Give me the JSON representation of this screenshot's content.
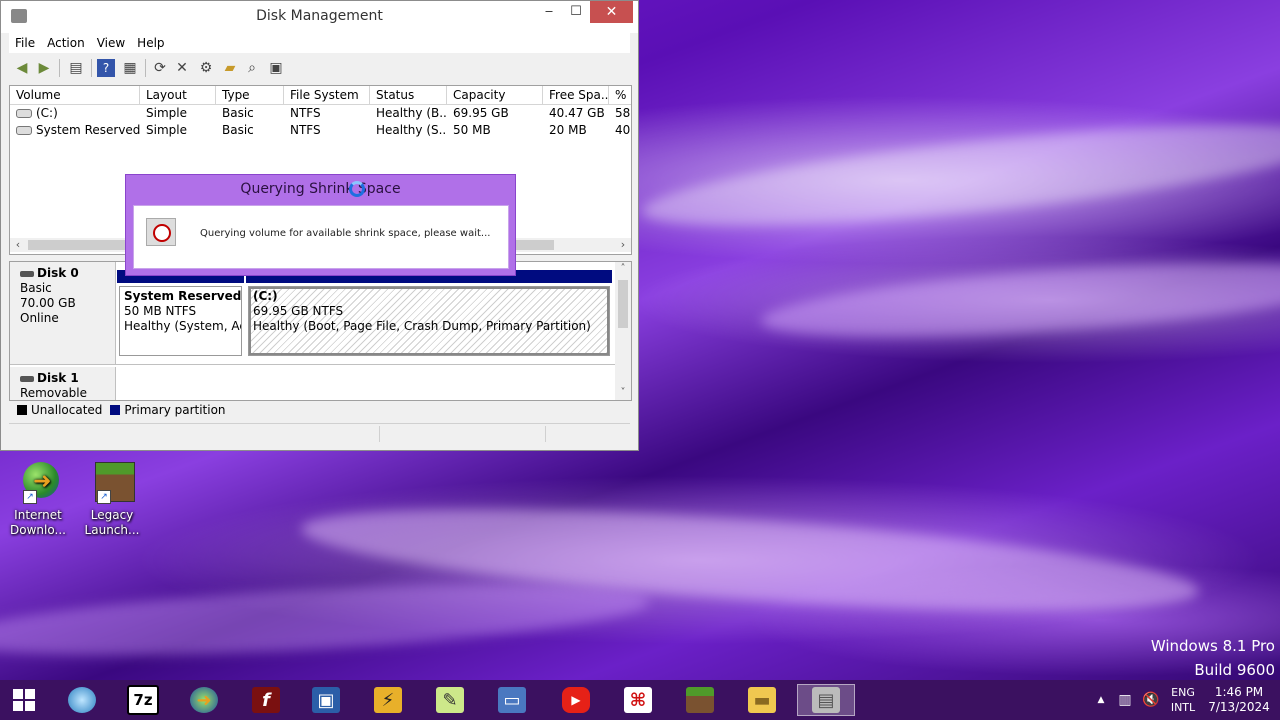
{
  "window": {
    "title": "Disk Management",
    "minimize": "‒",
    "maximize": "☐",
    "close": "✕",
    "menu": [
      "File",
      "Action",
      "View",
      "Help"
    ]
  },
  "volume_list": {
    "columns": [
      "Volume",
      "Layout",
      "Type",
      "File System",
      "Status",
      "Capacity",
      "Free Spa...",
      "% F"
    ],
    "rows": [
      [
        "(C:)",
        "Simple",
        "Basic",
        "NTFS",
        "Healthy (B...",
        "69.95 GB",
        "40.47 GB",
        "58"
      ],
      [
        "System Reserved",
        "Simple",
        "Basic",
        "NTFS",
        "Healthy (S...",
        "50 MB",
        "20 MB",
        "40"
      ]
    ]
  },
  "disks": [
    {
      "name": "Disk 0",
      "type": "Basic",
      "size": "70.00 GB",
      "state": "Online",
      "partitions": [
        {
          "name": "System Reserved",
          "size": "50 MB NTFS",
          "status": "Healthy (System, Acti"
        },
        {
          "name": "(C:)",
          "size": "69.95 GB NTFS",
          "status": "Healthy (Boot, Page File, Crash Dump, Primary Partition)"
        }
      ]
    },
    {
      "name": "Disk 1",
      "type": "Removable (D:)"
    }
  ],
  "legend": {
    "unallocated": "Unallocated",
    "primary": "Primary partition",
    "unallocated_color": "#000000",
    "primary_color": "#000b80"
  },
  "dialog": {
    "title": "Querying Shrink Space",
    "message": "Querying volume for available shrink space, please wait..."
  },
  "desktop_icons": [
    {
      "label": "Internet Downlo...",
      "icon": "internet-download-manager-icon"
    },
    {
      "label": "Legacy Launch...",
      "icon": "minecraft-icon"
    }
  ],
  "watermark": {
    "line1": "Windows 8.1 Pro",
    "line2": "Build 9600"
  },
  "taskbar": {
    "apps": [
      "7z"
    ],
    "lang_line1": "ENG",
    "lang_line2": "INTL",
    "time": "1:46 PM",
    "date": "7/13/2024",
    "show_hidden": "▲"
  }
}
